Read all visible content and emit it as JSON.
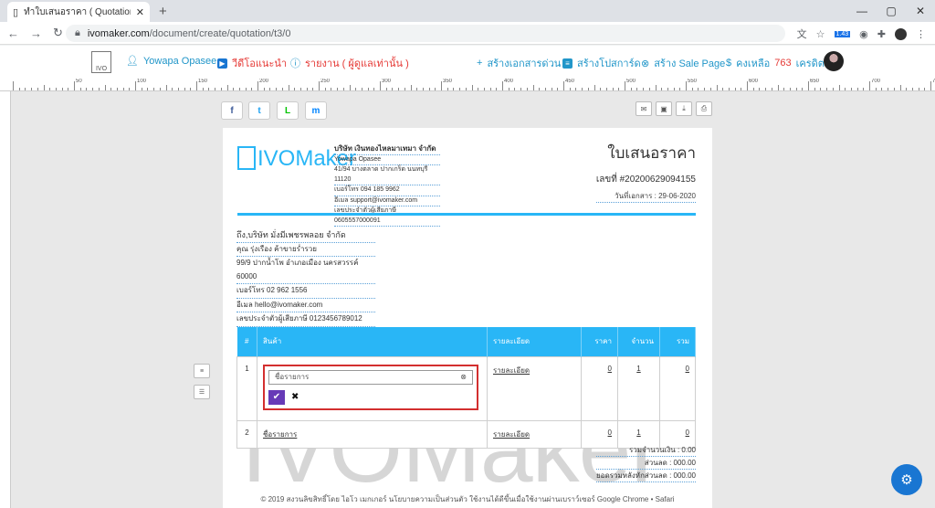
{
  "browser": {
    "tab_title": "ทำใบเสนอราคา ( Quotation ) ออนไล",
    "new_tab": "+",
    "url_host": "ivomaker.com",
    "url_path": "/document/create/quotation/t3/0",
    "ext_badge": "1.43"
  },
  "appbar": {
    "logo_text": "IVO",
    "user": "Yowapa Opasee",
    "video": "วีดีโอแนะนำ",
    "report": "รายงาน ( ผู้ดูแลเท่านั้น )",
    "quick_doc": "สร้างเอกสารด่วน",
    "create_card": "สร้างโปสการ์ด",
    "sale_page": "สร้าง Sale Page",
    "credit_prefix": "คงเหลือ",
    "credit_value": "763",
    "credit_suffix": "เครดิต"
  },
  "ruler_labels": [
    "50",
    "100",
    "150",
    "200",
    "250",
    "300",
    "350",
    "400",
    "450",
    "500",
    "550",
    "600",
    "650",
    "700",
    "750",
    "800",
    "850",
    "900",
    "950",
    "1000",
    "1050",
    "1100",
    "1150",
    "1200",
    "1250",
    "1300",
    "1350",
    "1400",
    "1450",
    "1500"
  ],
  "share": {
    "facebook": "f",
    "twitter": "t",
    "line": "L",
    "messenger": "m"
  },
  "doc": {
    "logo": "IVOMaker",
    "company": {
      "name": "บริษัท เงินทองไหลมาเทมา จำกัด",
      "contact": "Yowapa Opasee",
      "address": "41/94 บางตลาด ปากเกร็ด นนทบุรี 11120",
      "phone": "เบอร์โทร 094 185 9962",
      "email": "อีเมล support@ivomaker.com",
      "tax": "เลขประจำตัวผู้เสียภาษี 0605557000091"
    },
    "title": "ใบเสนอราคา",
    "number": "เลขที่  #20200629094155",
    "date": "วันที่เอกสาร : 29-06-2020",
    "customer": {
      "name": "ถึง,บริษัท มั่งมีเพชรพลอย จำกัด",
      "contact": "คุณ รุ่งเรือง ค้าขายร่ำรวย",
      "address": "99/9 ปากน้ำโพ อำเภอเมือง นครสวรรค์ 60000",
      "phone": "เบอร์โทร 02 962 1556",
      "email": "อีเมล hello@ivomaker.com",
      "tax": "เลขประจำตัวผู้เสียภาษี 0123456789012"
    },
    "table": {
      "headers": [
        "#",
        "สินค้า",
        "รายละเอียด",
        "ราคา",
        "จำนวน",
        "รวม"
      ],
      "rows": [
        {
          "idx": "1",
          "item_placeholder": "ชื่อรายการ",
          "detail": "รายละเอียด",
          "price": "0",
          "qty": "1",
          "total": "0"
        },
        {
          "idx": "2",
          "item": "ชื่อรายการ",
          "detail": "รายละเอียด",
          "price": "0",
          "qty": "1",
          "total": "0"
        }
      ]
    },
    "sums": {
      "subtotal": "รวมจำนวนเงิน : 0.00",
      "discount": "ส่วนลด : 000.00",
      "after_discount": "ยอดรวมหลังหักส่วนลด : 000.00"
    },
    "watermark": "IVOMaker"
  },
  "footer": "© 2019 สงวนลิขสิทธิ์โดย ไอโว เมกเกอร์ นโยบายความเป็นส่วนตัว ใช้งานได้ดีขึ้นเมื่อใช้งานผ่านเบราว์เซอร์ Google Chrome • Safari",
  "colors": {
    "accent": "#29b6f6",
    "link": "#2196c9",
    "red": "#e53935",
    "confirm": "#673ab7"
  }
}
